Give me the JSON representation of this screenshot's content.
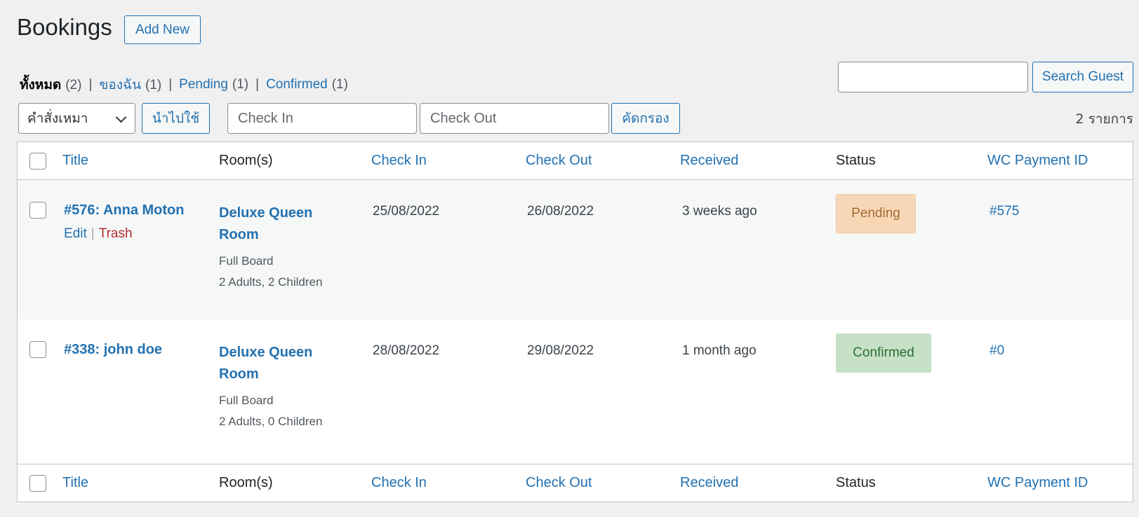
{
  "header": {
    "title": "Bookings",
    "add_new_label": "Add New"
  },
  "views": [
    {
      "label": "ทั้งหมด",
      "count": "(2)",
      "current": true
    },
    {
      "label": "ของฉัน",
      "count": "(1)"
    },
    {
      "label": "Pending",
      "count": "(1)"
    },
    {
      "label": "Confirmed",
      "count": "(1)"
    }
  ],
  "search": {
    "value": "",
    "button_label": "Search Guest"
  },
  "toolbar": {
    "bulk_action_selected": "คำสั่งเหมา",
    "apply_label": "นำไปใช้",
    "check_in_placeholder": "Check In",
    "check_out_placeholder": "Check Out",
    "filter_label": "คัดกรอง",
    "items_count": "2 รายการ"
  },
  "columns": {
    "title": "Title",
    "rooms": "Room(s)",
    "check_in": "Check In",
    "check_out": "Check Out",
    "received": "Received",
    "status": "Status",
    "wc_payment_id": "WC Payment ID"
  },
  "rows": [
    {
      "title": "#576:  Anna Moton",
      "actions": {
        "edit": "Edit",
        "separator": "|",
        "trash": "Trash"
      },
      "room": "Deluxe Queen Room",
      "board": "Full Board",
      "guests": "2 Adults, 2 Children",
      "check_in": "25/08/2022",
      "check_out": "26/08/2022",
      "received": "3 weeks ago",
      "status": "Pending",
      "payment_id": "#575"
    },
    {
      "title": "#338:  john doe",
      "room": "Deluxe Queen Room",
      "board": "Full Board",
      "guests": "2 Adults, 0 Children",
      "check_in": "28/08/2022",
      "check_out": "29/08/2022",
      "received": "1 month ago",
      "status": "Confirmed",
      "payment_id": "#0"
    }
  ],
  "colors": {
    "link": "#2271b1",
    "trash": "#b32d2e",
    "pending_bg": "#f8d7b7",
    "confirmed_bg": "#c6e1c6",
    "page_bg": "#f0f0f1"
  }
}
